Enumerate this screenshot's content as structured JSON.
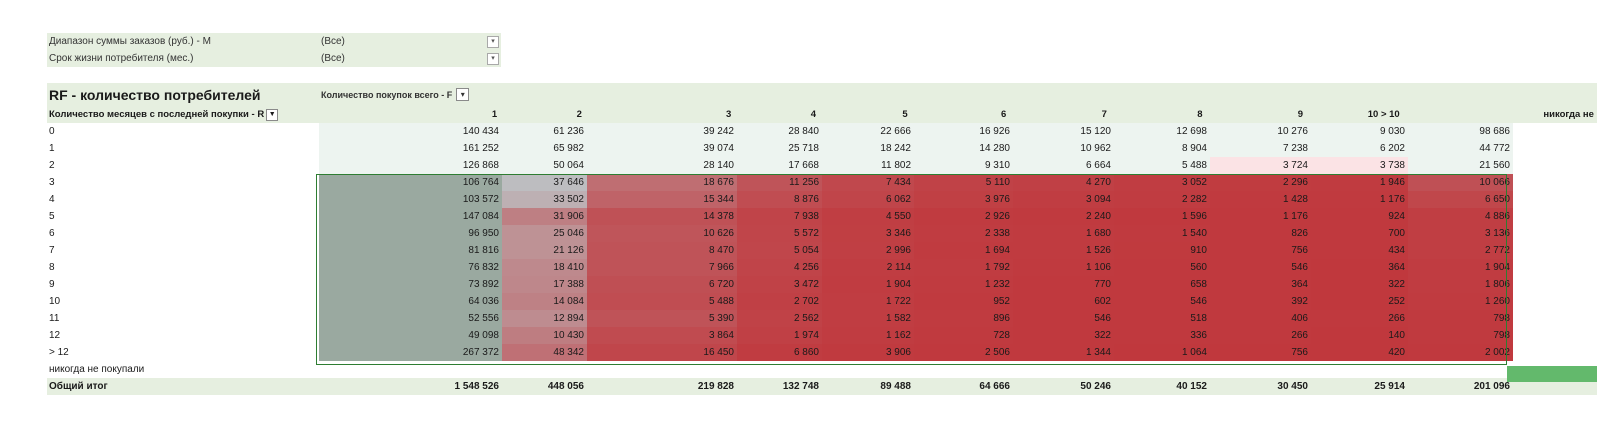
{
  "filters": [
    {
      "label": "Диапазон суммы заказов (руб.) - М",
      "value": "(Все)"
    },
    {
      "label": "Срок жизни потребителя (мес.)",
      "value": "(Все)"
    }
  ],
  "pivot": {
    "title": "RF - количество потребителей",
    "column_field": "Количество покупок всего - F",
    "row_field": "Количество месяцев с последней покупки - R",
    "column_headers": [
      "1",
      "2",
      "3",
      "4",
      "5",
      "6",
      "7",
      "8",
      "9",
      "10 > 10",
      "",
      "никогда не"
    ],
    "rows": [
      {
        "label": "0",
        "cells": [
          "140 434",
          "61 236",
          "39 242",
          "28 840",
          "22 666",
          "16 926",
          "15 120",
          "12 698",
          "10 276",
          "9 030",
          "98 686"
        ]
      },
      {
        "label": "1",
        "cells": [
          "161 252",
          "65 982",
          "39 074",
          "25 718",
          "18 242",
          "14 280",
          "10 962",
          "8 904",
          "7 238",
          "6 202",
          "44 772"
        ]
      },
      {
        "label": "2",
        "cells": [
          "126 868",
          "50 064",
          "28 140",
          "17 668",
          "11 802",
          "9 310",
          "6 664",
          "5 488",
          "3 724",
          "3 738",
          "21 560"
        ]
      },
      {
        "label": "3",
        "cells": [
          "106 764",
          "37 646",
          "18 676",
          "11 256",
          "7 434",
          "5 110",
          "4 270",
          "3 052",
          "2 296",
          "1 946",
          "10 066"
        ]
      },
      {
        "label": "4",
        "cells": [
          "103 572",
          "33 502",
          "15 344",
          "8 876",
          "6 062",
          "3 976",
          "3 094",
          "2 282",
          "1 428",
          "1 176",
          "6 650"
        ]
      },
      {
        "label": "5",
        "cells": [
          "147 084",
          "31 906",
          "14 378",
          "7 938",
          "4 550",
          "2 926",
          "2 240",
          "1 596",
          "1 176",
          "924",
          "4 886"
        ]
      },
      {
        "label": "6",
        "cells": [
          "96 950",
          "25 046",
          "10 626",
          "5 572",
          "3 346",
          "2 338",
          "1 680",
          "1 540",
          "826",
          "700",
          "3 136"
        ]
      },
      {
        "label": "7",
        "cells": [
          "81 816",
          "21 126",
          "8 470",
          "5 054",
          "2 996",
          "1 694",
          "1 526",
          "910",
          "756",
          "434",
          "2 772"
        ]
      },
      {
        "label": "8",
        "cells": [
          "76 832",
          "18 410",
          "7 966",
          "4 256",
          "2 114",
          "1 792",
          "1 106",
          "560",
          "546",
          "364",
          "1 904"
        ]
      },
      {
        "label": "9",
        "cells": [
          "73 892",
          "17 388",
          "6 720",
          "3 472",
          "1 904",
          "1 232",
          "770",
          "658",
          "364",
          "322",
          "1 806"
        ]
      },
      {
        "label": "10",
        "cells": [
          "64 036",
          "14 084",
          "5 488",
          "2 702",
          "1 722",
          "952",
          "602",
          "546",
          "392",
          "252",
          "1 260"
        ]
      },
      {
        "label": "11",
        "cells": [
          "52 556",
          "12 894",
          "5 390",
          "2 562",
          "1 582",
          "896",
          "546",
          "518",
          "406",
          "266",
          "798"
        ]
      },
      {
        "label": "12",
        "cells": [
          "49 098",
          "10 430",
          "3 864",
          "1 974",
          "1 162",
          "728",
          "322",
          "336",
          "266",
          "140",
          "798"
        ]
      },
      {
        "label": "> 12",
        "cells": [
          "267 372",
          "48 342",
          "16 450",
          "6 860",
          "3 906",
          "2 506",
          "1 344",
          "1 064",
          "756",
          "420",
          "2 002"
        ]
      },
      {
        "label": "никогда не покупали",
        "cells": [
          "",
          "",
          "",
          "",
          "",
          "",
          "",
          "",
          "",
          "",
          ""
        ]
      }
    ],
    "total": {
      "label": "Общий итог",
      "cells": [
        "1 548 526",
        "448 056",
        "219 828",
        "132 748",
        "89 488",
        "64 666",
        "50 246",
        "40 152",
        "30 450",
        "25 914",
        "201 096"
      ]
    }
  },
  "colors": {
    "band": "#e6efe0",
    "selection": "#2e7d32",
    "heat_high": "#c0383d",
    "heat_low": "#e8f1ec",
    "grey": "#bdbdc0"
  }
}
